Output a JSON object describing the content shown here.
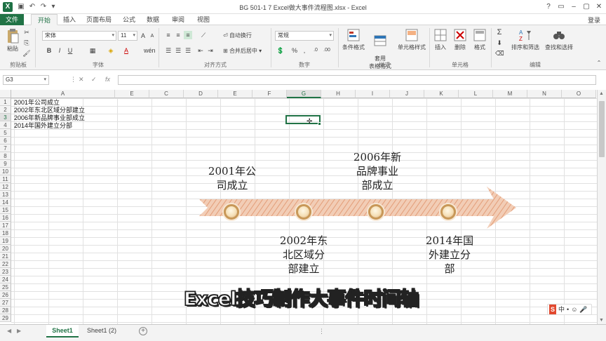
{
  "window": {
    "title": "BG 501-1 7 Excel做大事件流程图.xlsx - Excel",
    "signin": "登录",
    "app_icon": "X"
  },
  "tabs": [
    "文件",
    "开始",
    "插入",
    "页面布局",
    "公式",
    "数据",
    "审阅",
    "视图"
  ],
  "ribbon": {
    "paste": "粘贴",
    "font_name": "宋体",
    "font_size": "11",
    "bold": "B",
    "italic": "I",
    "underline": "U",
    "wrap_text": "自动换行",
    "merge_center": "合并后居中",
    "number_format": "常规",
    "percent": "%",
    "comma": ",",
    "conditional_format": "条件格式",
    "format_table": "套用\n表格格式",
    "cell_style": "单元格样式",
    "insert": "插入",
    "delete": "删除",
    "format": "格式",
    "sort_filter": "排序和筛选",
    "find_select": "查找和选择",
    "groups": [
      "剪贴板",
      "字体",
      "对齐方式",
      "数字",
      "样式",
      "单元格",
      "编辑"
    ]
  },
  "formula_bar": {
    "name_box": "G3",
    "cancel": "✕",
    "enter": "✓",
    "fx": "fx"
  },
  "columns": [
    "A",
    "E",
    "C",
    "D",
    "E",
    "F",
    "G",
    "H",
    "I",
    "J",
    "K",
    "L",
    "M",
    "N",
    "O"
  ],
  "rows": [
    "1",
    "2",
    "3",
    "4",
    "5",
    "6",
    "7",
    "8",
    "9",
    "10",
    "11",
    "12",
    "13",
    "14",
    "15",
    "16",
    "17",
    "18",
    "19",
    "20",
    "21",
    "22",
    "23",
    "24",
    "25",
    "26",
    "27",
    "28",
    "29"
  ],
  "cells": [
    "2001年公司成立",
    "2002年东北区域分部建立",
    "2006年新品牌事业部成立",
    "2014年国外建立分部"
  ],
  "timeline": {
    "top_labels": [
      {
        "lines": [
          "2001年公",
          "司成立"
        ]
      },
      {
        "lines": [
          "2006年新",
          "品牌事业",
          "部成立"
        ]
      }
    ],
    "bottom_labels": [
      {
        "lines": [
          "2002年东",
          "北区域分",
          "部建立"
        ]
      },
      {
        "lines": [
          "2014年国",
          "外建立分",
          "部"
        ]
      }
    ],
    "arrow_color": "#e8b496"
  },
  "banner": "Excel技巧制作大事件时间轴",
  "sheets": [
    "Sheet1",
    "Sheet1 (2)"
  ],
  "ime": [
    "S",
    "中",
    "•",
    "☺",
    "🎤"
  ]
}
